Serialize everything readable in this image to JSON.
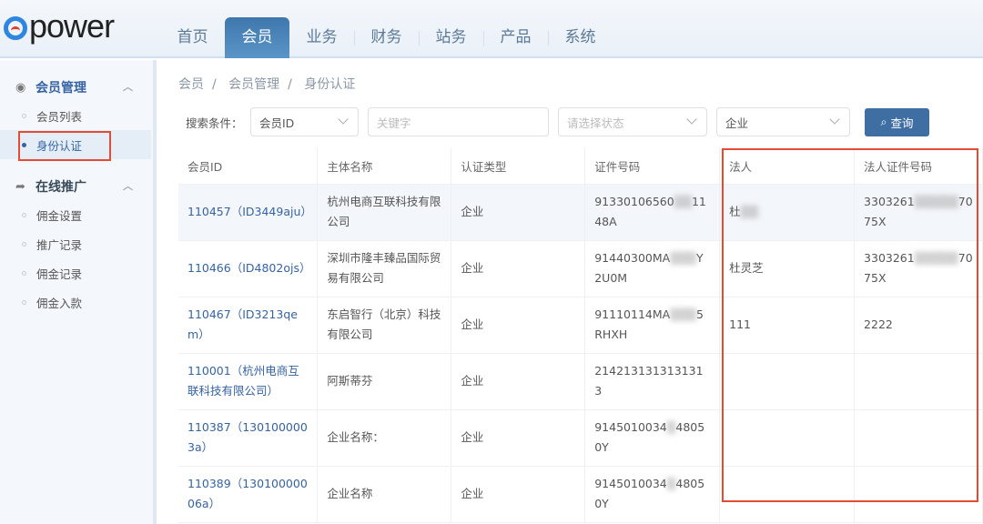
{
  "app": {
    "logo": "power"
  },
  "nav": {
    "tabs": [
      "首页",
      "会员",
      "业务",
      "财务",
      "站务",
      "产品",
      "系统"
    ],
    "active": 1
  },
  "sidebar": {
    "groups": [
      {
        "label": "会员管理",
        "icon": "user-circle-icon",
        "items": [
          "会员列表",
          "身份认证"
        ],
        "active": 1
      },
      {
        "label": "在线推广",
        "icon": "share-arrow-icon",
        "items": [
          "佣金设置",
          "推广记录",
          "佣金记录",
          "佣金入款"
        ]
      }
    ]
  },
  "breadcrumb": [
    "会员",
    "会员管理",
    "身份认证"
  ],
  "filters": {
    "label": "搜索条件：",
    "field": "会员ID",
    "keyword_placeholder": "关键字",
    "status_placeholder": "请选择状态",
    "type": "企业",
    "search_button": "查询"
  },
  "table": {
    "columns": [
      "会员ID",
      "主体名称",
      "认证类型",
      "证件号码",
      "法人",
      "法人证件号码"
    ],
    "rows": [
      [
        [
          "110457（ID3449aju）"
        ],
        [
          "杭州电商互联科技有限公司"
        ],
        [
          "企业"
        ],
        [
          "91330106560",
          "▒▒",
          "1148A"
        ],
        [
          "杜",
          "▒▒",
          ""
        ],
        [
          "3303261",
          "▒▒▒▒▒",
          "7075X"
        ]
      ],
      [
        [
          "110466（ID4802ojs）"
        ],
        [
          "深圳市隆丰臻品国际贸易有限公司"
        ],
        [
          "企业"
        ],
        [
          "91440300MA",
          "▒▒▒",
          "Y2U0M"
        ],
        [
          "杜灵芝"
        ],
        [
          "3303261",
          "▒▒▒▒▒",
          "7075X"
        ]
      ],
      [
        [
          "110467（ID3213qem）"
        ],
        [
          "东启智行（北京）科技有限公司"
        ],
        [
          "企业"
        ],
        [
          "91110114MA",
          "▒▒▒",
          "5RHXH"
        ],
        [
          "111"
        ],
        [
          "2222"
        ]
      ],
      [
        [
          "110001（杭州电商互联科技有限公司）"
        ],
        [
          "阿斯蒂芬"
        ],
        [
          "企业"
        ],
        [
          "2142131313131313"
        ],
        [
          ""
        ],
        [
          ""
        ]
      ],
      [
        [
          "110387（1301000003a）"
        ],
        [
          "企业名称："
        ],
        [
          "企业"
        ],
        [
          "9145010034",
          "▒",
          "48050Y"
        ],
        [
          ""
        ],
        [
          ""
        ]
      ],
      [
        [
          "110389（13010000006a）"
        ],
        [
          "企业名称"
        ],
        [
          "企业"
        ],
        [
          "9145010034",
          "▒",
          "48050Y"
        ],
        [
          ""
        ],
        [
          ""
        ]
      ]
    ]
  },
  "colors": {
    "accent": "#3563a3",
    "highlight": "#e44b32",
    "button": "#3f6ea3"
  }
}
